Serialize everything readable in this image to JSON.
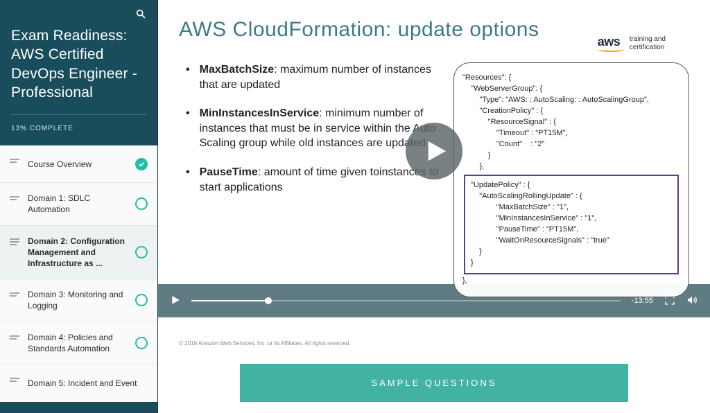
{
  "sidebar": {
    "course_title": "Exam Readiness: AWS Certified DevOps Engineer - Professional",
    "progress": "13% COMPLETE",
    "items": [
      {
        "label": "Course Overview",
        "status": "complete"
      },
      {
        "label": "Domain 1: SDLC Automation",
        "status": "ring"
      },
      {
        "label": "Domain 2: Configuration Management and Infrastructure as ...",
        "status": "ring",
        "active": true
      },
      {
        "label": "Domain 3: Monitoring and Logging",
        "status": "ring"
      },
      {
        "label": "Domain 4: Policies and Standards Automation",
        "status": "ring"
      },
      {
        "label": "Domain 5: Incident and Event",
        "status": "ring"
      }
    ]
  },
  "slide": {
    "title": "AWS CloudFormation: update options",
    "aws_tag1": "training and",
    "aws_tag2": "certification",
    "bullets": {
      "b1_strong": "MaxBatchSize",
      "b1_rest": ": maximum number of instances that are updated",
      "b2_strong": "MinInstancesInService",
      "b2_rest": ": minimum number of instances that must be in service within the Auto Scaling group while old instances are updated",
      "b3_strong": "PauseTime",
      "b3_rest": ": amount of time given toinstances to start applications"
    },
    "code_top": [
      "\"Resources\": {",
      "    \"WebServerGroup\": {",
      "        \"Type\": \"AWS: : AutoScaling: : AutoScalingGroup\",",
      "        \"CreationPolicy\" : {",
      "            \"ResourceSignal\" : {",
      "                \"Timeout\" : \"PT15M\",",
      "                \"Count\"    : \"2\"",
      "            }",
      "        },"
    ],
    "code_hl": [
      "\"UpdatePolicy\" : {",
      "    \"AutoScalingRollingUpdate\" : {",
      "            \"MaxBatchSize\" : \"1\",",
      "            \"MinInstancesInService\" : \"1\",",
      "            \"PauseTime\" : \"PT15M\",",
      "            \"WaitOnResourceSignals\" : \"true\"",
      "    }",
      "}"
    ],
    "code_bottom": "},",
    "copyright": "© 2019 Amazon Web Services, Inc. or its Affiliates. All rights reserved."
  },
  "player": {
    "time": "-13:55"
  },
  "cta": {
    "label": "SAMPLE QUESTIONS"
  }
}
